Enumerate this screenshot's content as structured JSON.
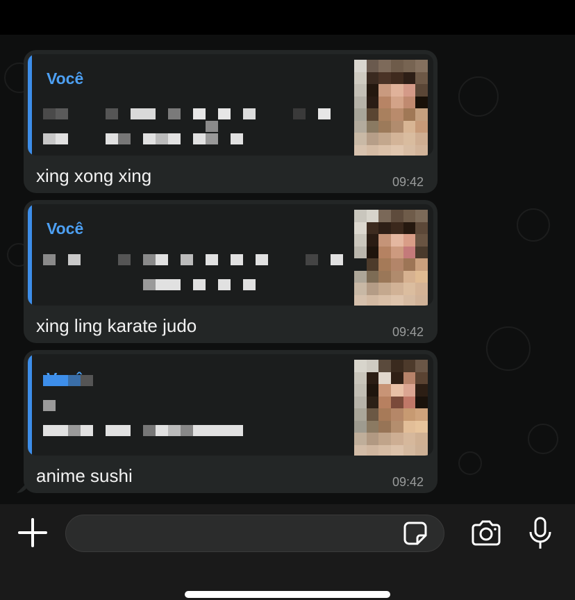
{
  "messages": [
    {
      "quote_author": "Você",
      "text": "xing xong xing",
      "time": "09:42"
    },
    {
      "quote_author": "Você",
      "text": "xing ling karate judo",
      "time": "09:42"
    },
    {
      "quote_author": "Você",
      "text": "anime sushi",
      "time": "09:42"
    }
  ],
  "composer": {
    "value": ""
  },
  "icons": {
    "attach": "plus-icon",
    "sticker": "sticker-icon",
    "camera": "camera-icon",
    "voice": "microphone-icon"
  },
  "colors": {
    "background": "#0e0f0f",
    "bubble": "#232626",
    "quote_accent": "#3d8eea",
    "quote_author": "#4da0f3",
    "text": "#f2f2f2",
    "time": "#9a9c9c"
  }
}
